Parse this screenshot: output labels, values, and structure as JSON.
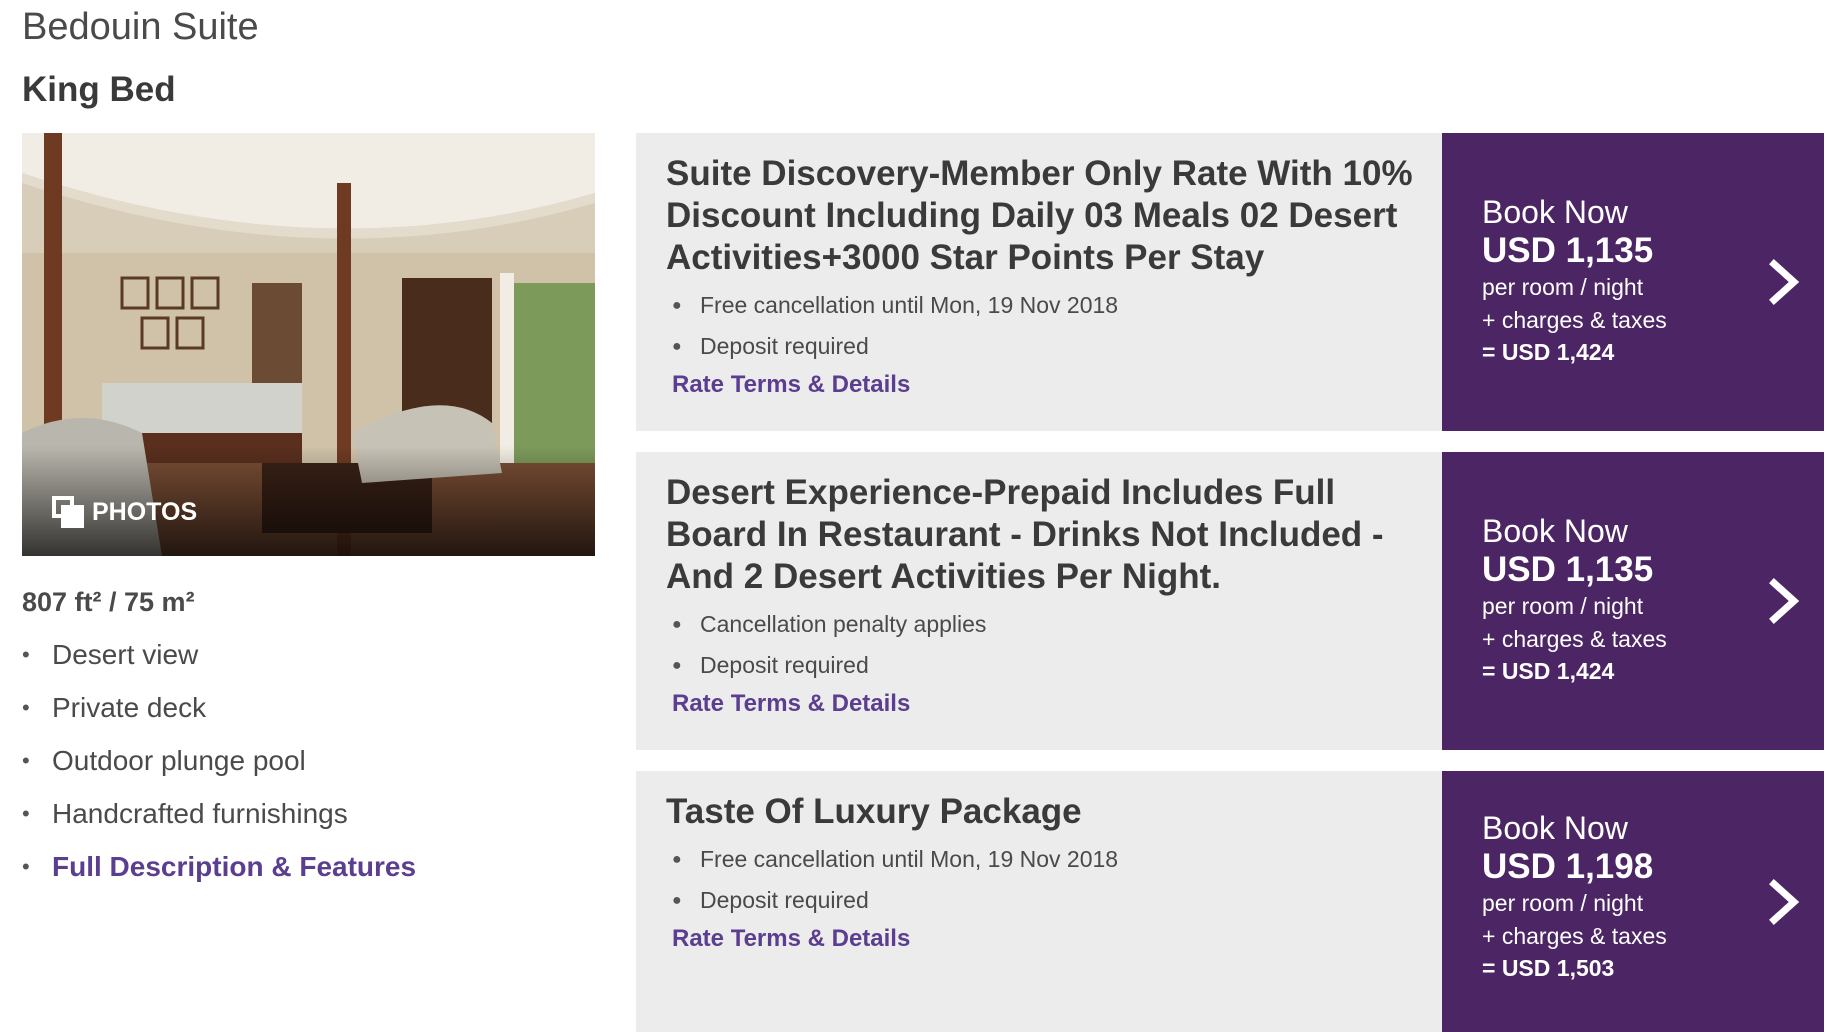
{
  "room": {
    "suite_name": "Bedouin Suite",
    "bed_type": "King Bed",
    "photos_label": "PHOTOS",
    "size": "807 ft² / 75 m²",
    "features": [
      "Desert view",
      "Private deck",
      "Outdoor plunge pool",
      "Handcrafted furnishings"
    ],
    "full_description_link": "Full Description & Features"
  },
  "rates": [
    {
      "title": "Suite Discovery-Member Only Rate With 10% Discount Including Daily 03 Meals 02 Desert Activities+3000 Star Points Per Stay",
      "bullets": [
        "Free cancellation until Mon, 19 Nov 2018",
        "Deposit required"
      ],
      "terms_link": "Rate Terms & Details",
      "book_label": "Book Now",
      "price": "USD 1,135",
      "per": "per room / night",
      "charges": "+ charges & taxes",
      "total": "= USD 1,424"
    },
    {
      "title": "Desert Experience-Prepaid Includes Full Board In Restaurant - Drinks Not Included - And 2 Desert Activities Per Night.",
      "bullets": [
        "Cancellation penalty applies",
        "Deposit required"
      ],
      "terms_link": "Rate Terms & Details",
      "book_label": "Book Now",
      "price": "USD 1,135",
      "per": "per room / night",
      "charges": "+ charges & taxes",
      "total": "= USD 1,424"
    },
    {
      "title": "Taste Of Luxury Package",
      "bullets": [
        "Free cancellation until Mon, 19 Nov 2018",
        "Deposit required"
      ],
      "terms_link": "Rate Terms & Details",
      "book_label": "Book Now",
      "price": "USD 1,198",
      "per": "per room / night",
      "charges": "+ charges & taxes",
      "total": "= USD 1,503"
    }
  ],
  "colors": {
    "accent_purple": "#4c2564",
    "link_purple": "#5b3e8f",
    "panel_gray": "#ececec"
  },
  "icons": {
    "photos": "photos-icon",
    "book_arrow": "chevron-right-icon"
  }
}
